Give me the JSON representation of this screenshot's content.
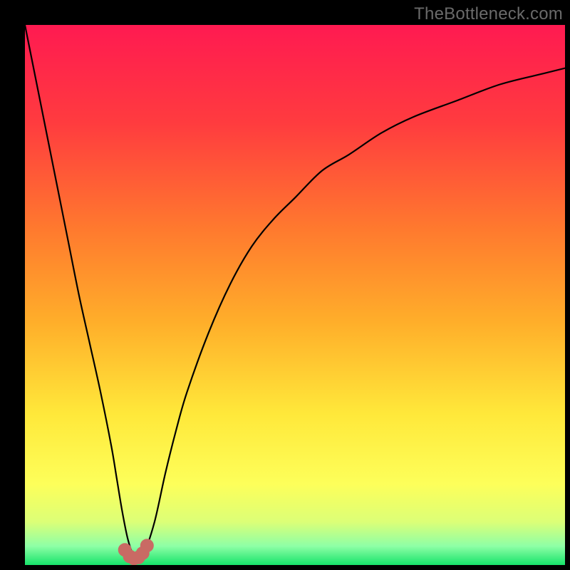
{
  "watermark": "TheBottleneck.com",
  "colors": {
    "frame": "#000000",
    "curve": "#000000",
    "markerFill": "#c96a64",
    "markerStroke": "#c96a64",
    "gradientStops": [
      {
        "offset": 0.0,
        "color": "#ff1a51"
      },
      {
        "offset": 0.18,
        "color": "#ff3b3f"
      },
      {
        "offset": 0.38,
        "color": "#ff7a2e"
      },
      {
        "offset": 0.55,
        "color": "#ffae2a"
      },
      {
        "offset": 0.72,
        "color": "#ffe83a"
      },
      {
        "offset": 0.85,
        "color": "#fdff5a"
      },
      {
        "offset": 0.92,
        "color": "#dcff77"
      },
      {
        "offset": 0.965,
        "color": "#8effa6"
      },
      {
        "offset": 1.0,
        "color": "#17e36a"
      }
    ]
  },
  "chart_data": {
    "type": "line",
    "title": "",
    "xlabel": "",
    "ylabel": "",
    "xlim": [
      0,
      100
    ],
    "ylim": [
      0,
      100
    ],
    "legend": false,
    "grid": false,
    "series": [
      {
        "name": "curve",
        "x": [
          0,
          2,
          4,
          6,
          8,
          10,
          12,
          14,
          16,
          17,
          18,
          19,
          20,
          21,
          22,
          24,
          26,
          28,
          30,
          34,
          38,
          42,
          46,
          50,
          55,
          60,
          66,
          72,
          80,
          88,
          96,
          100
        ],
        "y": [
          100,
          90,
          80,
          70,
          60,
          50,
          41,
          32,
          22,
          16,
          10,
          5,
          2,
          1,
          2,
          8,
          17,
          25,
          32,
          43,
          52,
          59,
          64,
          68,
          73,
          76,
          80,
          83,
          86,
          89,
          91,
          92
        ]
      }
    ],
    "markers": [
      {
        "x": 18.5,
        "y": 2.8
      },
      {
        "x": 19.4,
        "y": 1.6
      },
      {
        "x": 20.2,
        "y": 1.2
      },
      {
        "x": 21.0,
        "y": 1.4
      },
      {
        "x": 21.8,
        "y": 2.2
      },
      {
        "x": 22.6,
        "y": 3.6
      }
    ]
  }
}
